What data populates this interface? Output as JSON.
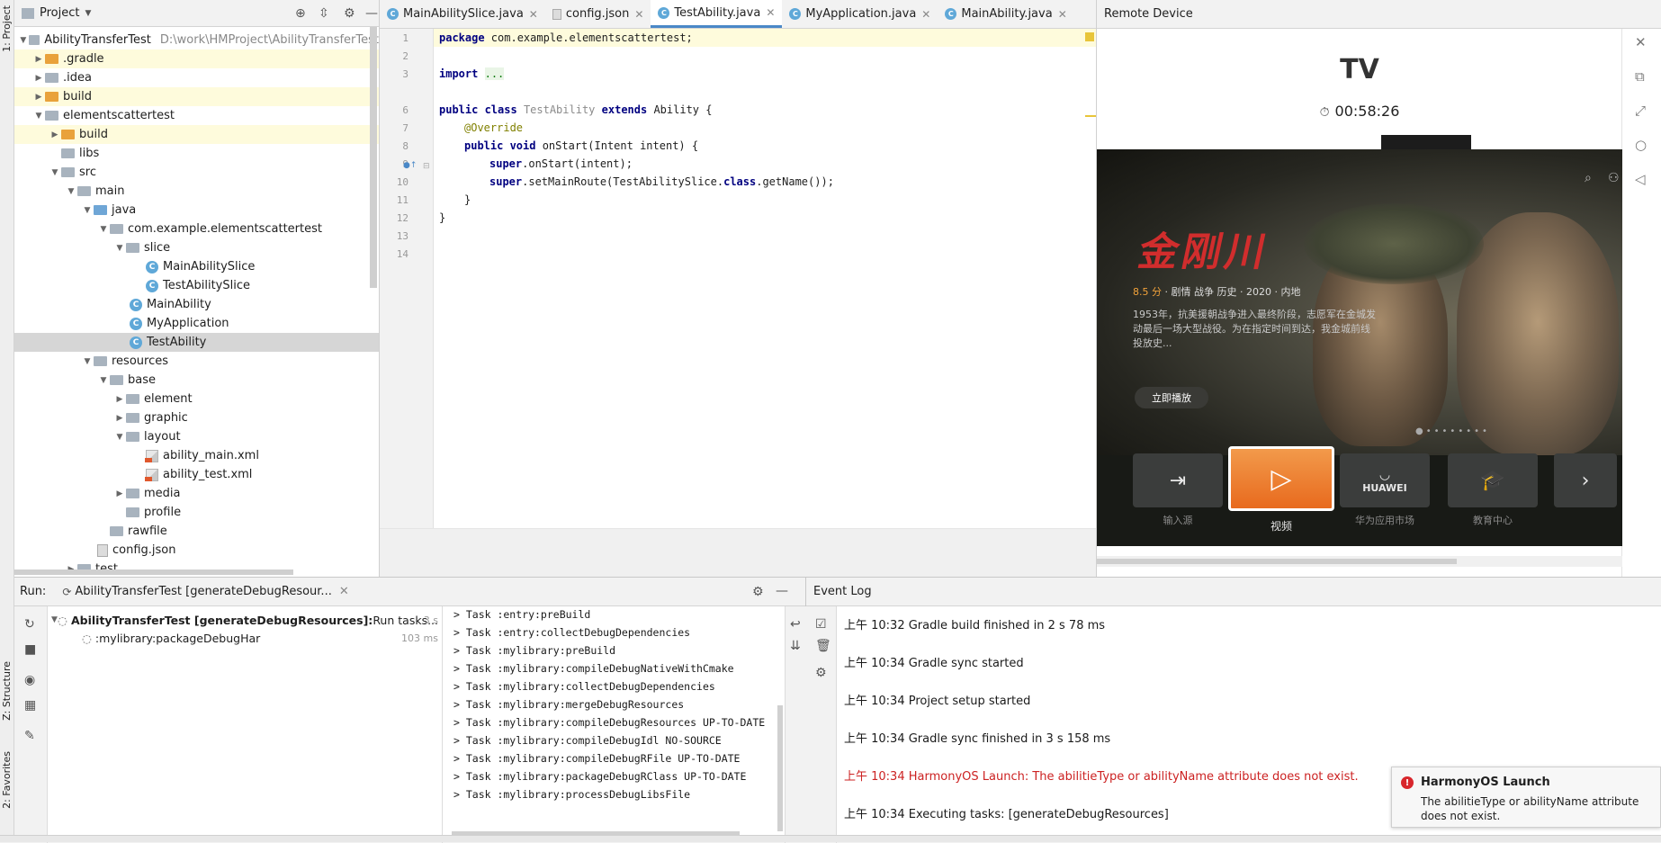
{
  "side_tabs": {
    "project": "1: Project",
    "structure": "Z: Structure",
    "favorites": "2: Favorites"
  },
  "project_panel": {
    "title": "Project",
    "tree": [
      {
        "label": "AbilityTransferTest",
        "path": "D:\\work\\HMProject\\AbilityTransferTest"
      },
      {
        "label": ".gradle"
      },
      {
        "label": ".idea"
      },
      {
        "label": "build"
      },
      {
        "label": "elementscattertest"
      },
      {
        "label": "build"
      },
      {
        "label": "libs"
      },
      {
        "label": "src"
      },
      {
        "label": "main"
      },
      {
        "label": "java"
      },
      {
        "label": "com.example.elementscattertest"
      },
      {
        "label": "slice"
      },
      {
        "label": "MainAbilitySlice"
      },
      {
        "label": "TestAbilitySlice"
      },
      {
        "label": "MainAbility"
      },
      {
        "label": "MyApplication"
      },
      {
        "label": "TestAbility"
      },
      {
        "label": "resources"
      },
      {
        "label": "base"
      },
      {
        "label": "element"
      },
      {
        "label": "graphic"
      },
      {
        "label": "layout"
      },
      {
        "label": "ability_main.xml"
      },
      {
        "label": "ability_test.xml"
      },
      {
        "label": "media"
      },
      {
        "label": "profile"
      },
      {
        "label": "rawfile"
      },
      {
        "label": "config.json"
      },
      {
        "label": "test"
      }
    ]
  },
  "editor": {
    "tabs": [
      {
        "label": "MainAbilitySlice.java"
      },
      {
        "label": "config.json"
      },
      {
        "label": "TestAbility.java"
      },
      {
        "label": "MyApplication.java"
      },
      {
        "label": "MainAbility.java"
      }
    ],
    "line_numbers": [
      "1",
      "2",
      "3",
      "6",
      "7",
      "8",
      "9",
      "10",
      "11",
      "12",
      "13",
      "14"
    ],
    "code": {
      "l1_kw": "package",
      "l1_rest": " com.example.elementscattertest;",
      "l3_kw": "import",
      "l3_fold": "...",
      "l7_kw1": "public class",
      "l7_name": "TestAbility",
      "l7_kw2": "extends",
      "l7_rest": " Ability {",
      "l8_ann": "@Override",
      "l9_kw": "public void",
      "l9_rest": " onStart(Intent intent) {",
      "l10_kw": "super",
      "l10_rest": ".onStart(intent);",
      "l11_kw": "super",
      "l11_mid": ".setMainRoute(TestAbilitySlice.",
      "l11_kw2": "class",
      "l11_rest": ".getName());",
      "l12": "}",
      "l13": "}"
    }
  },
  "remote_device": {
    "header": "Remote Device",
    "device_name": "TV",
    "clock": "00:58:26",
    "movie": {
      "logo": "金刚川",
      "score": "8.5 分",
      "meta": " · 剧情 战争 历史 · 2020 · 内地",
      "description": "1953年，抗美援朝战争进入最终阶段，志愿军在金城发动最后一场大型战役。为在指定时间到达，我金城前线投放史...",
      "play_button": "立即播放"
    },
    "tiles": [
      {
        "label": "输入源"
      },
      {
        "label": "视频"
      },
      {
        "label": "华为应用市场",
        "brand": "HUAWEI"
      },
      {
        "label": "教育中心"
      }
    ]
  },
  "run_panel": {
    "label": "Run:",
    "tab": "AbilityTransferTest [generateDebugResour...",
    "tree": [
      {
        "label": "AbilityTransferTest [generateDebugResources]:",
        "suffix": " Run tasks...",
        "time": "3 s"
      },
      {
        "label": ":mylibrary:packageDebugHar",
        "time": "103 ms"
      }
    ],
    "console": [
      "> Task :entry:preBuild",
      "> Task :entry:collectDebugDependencies",
      "> Task :mylibrary:preBuild",
      "> Task :mylibrary:compileDebugNativeWithCmake",
      "> Task :mylibrary:collectDebugDependencies",
      "> Task :mylibrary:mergeDebugResources",
      "> Task :mylibrary:compileDebugResources UP-TO-DATE",
      "> Task :mylibrary:compileDebugIdl NO-SOURCE",
      "> Task :mylibrary:compileDebugRFile UP-TO-DATE",
      "> Task :mylibrary:packageDebugRClass UP-TO-DATE",
      "> Task :mylibrary:processDebugLibsFile"
    ]
  },
  "event_log": {
    "title": "Event Log",
    "entries": [
      {
        "text": "上午 10:32 Gradle build finished in 2 s 78 ms"
      },
      {
        "text": "上午 10:34 Gradle sync started"
      },
      {
        "text": "上午 10:34 Project setup started"
      },
      {
        "text": "上午 10:34 Gradle sync finished in 3 s 158 ms"
      },
      {
        "text": "上午 10:34 HarmonyOS Launch: The abilitieType or abilityName attribute does not exist."
      },
      {
        "text": "上午 10:34 Executing tasks: [generateDebugResources]"
      }
    ],
    "balloon": {
      "title": "HarmonyOS Launch",
      "body": "The abilitieType or abilityName attribute does not exist."
    }
  },
  "colors": {
    "accent": "#4a88c7",
    "error": "#cc2222",
    "highlight": "#fefbdc",
    "tv_orange": "#e86a1e"
  }
}
